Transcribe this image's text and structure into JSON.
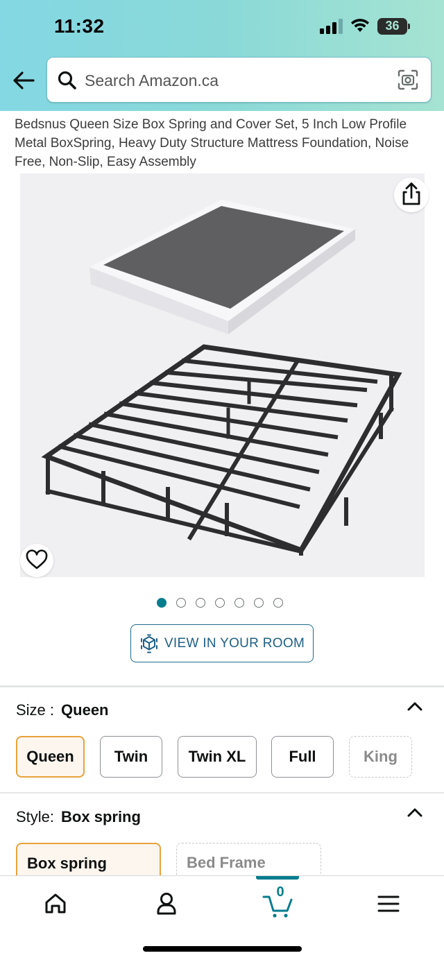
{
  "status_bar": {
    "time": "11:32",
    "battery": "36"
  },
  "search": {
    "placeholder": "Search Amazon.ca"
  },
  "product": {
    "title": "Bedsnus Queen Size Box Spring and Cover Set, 5 Inch Low Profile Metal BoxSpring, Heavy Duty Structure Mattress Foundation, Noise Free, Non-Slip, Easy Assembly"
  },
  "gallery": {
    "image_count": 7,
    "active_index": 0
  },
  "view_in_room": {
    "label": "VIEW IN YOUR ROOM"
  },
  "size": {
    "key": "Size :",
    "selected": "Queen",
    "options": [
      {
        "label": "Queen",
        "state": "selected"
      },
      {
        "label": "Twin",
        "state": "available"
      },
      {
        "label": "Twin XL",
        "state": "available"
      },
      {
        "label": "Full",
        "state": "available"
      },
      {
        "label": "King",
        "state": "unavailable"
      }
    ]
  },
  "style": {
    "key": "Style:",
    "selected": "Box spring",
    "options": [
      {
        "label": "Box spring",
        "state": "selected"
      },
      {
        "label": "Bed Frame",
        "state": "unavailable"
      }
    ]
  },
  "bottom_nav": {
    "items": [
      {
        "name": "home",
        "icon": "home-icon"
      },
      {
        "name": "account",
        "icon": "person-icon"
      },
      {
        "name": "cart",
        "icon": "cart-icon"
      },
      {
        "name": "menu",
        "icon": "menu-icon"
      }
    ],
    "cart_count": "0"
  },
  "colors": {
    "accent": "#067d8f",
    "selected_border": "#e9a23b",
    "header_start": "#84d8e3",
    "header_end": "#a6e3d2"
  }
}
